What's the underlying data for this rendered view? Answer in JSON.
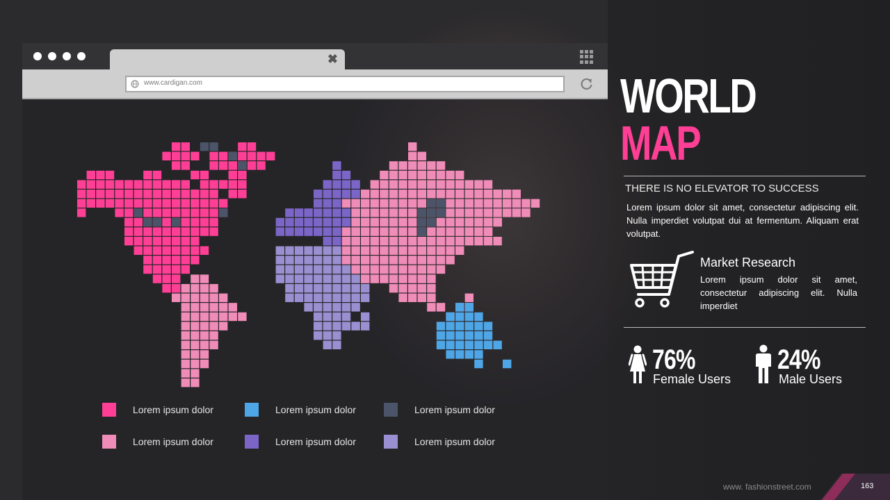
{
  "browser": {
    "url": "www.cardigan.com",
    "tab_close_glyph": "✖"
  },
  "colors": {
    "hot_pink": "#ff3f95",
    "light_pink": "#f08cb8",
    "sky_blue": "#4fa6e6",
    "slate": "#4b5468",
    "violet": "#7b66c8",
    "lavender": "#9a8fd0",
    "title_accent": "#ff3f95"
  },
  "legend": [
    {
      "label": "Lorem ipsum dolor",
      "color": "#ff3f95"
    },
    {
      "label": "Lorem ipsum dolor",
      "color": "#4fa6e6"
    },
    {
      "label": "Lorem ipsum dolor",
      "color": "#4b5468"
    },
    {
      "label": "Lorem ipsum dolor",
      "color": "#f08cb8"
    },
    {
      "label": "Lorem ipsum dolor",
      "color": "#7b66c8"
    },
    {
      "label": "Lorem ipsum dolor",
      "color": "#9a8fd0"
    }
  ],
  "heading": {
    "line1": "WORLD",
    "line2": "MAP"
  },
  "intro": {
    "subtitle": "THERE IS NO ELEVATOR TO SUCCESS",
    "body": "Lorem ipsum dolor sit amet, consectetur adipiscing elit. Nulla imperdiet volutpat dui at fermentum. Aliquam erat volutpat."
  },
  "feature": {
    "icon": "shopping-cart-icon",
    "title": "Market Research",
    "body": "Lorem ipsum dolor sit amet, consectetur adipiscing elit. Nulla imperdiet"
  },
  "stats": {
    "female": {
      "value": "76%",
      "label": "Female Users",
      "icon": "female-user-icon"
    },
    "male": {
      "value": "24%",
      "label": "Male Users",
      "icon": "male-user-icon"
    }
  },
  "footer": {
    "website": "www. fashionstreet.com",
    "page_number": "163"
  }
}
